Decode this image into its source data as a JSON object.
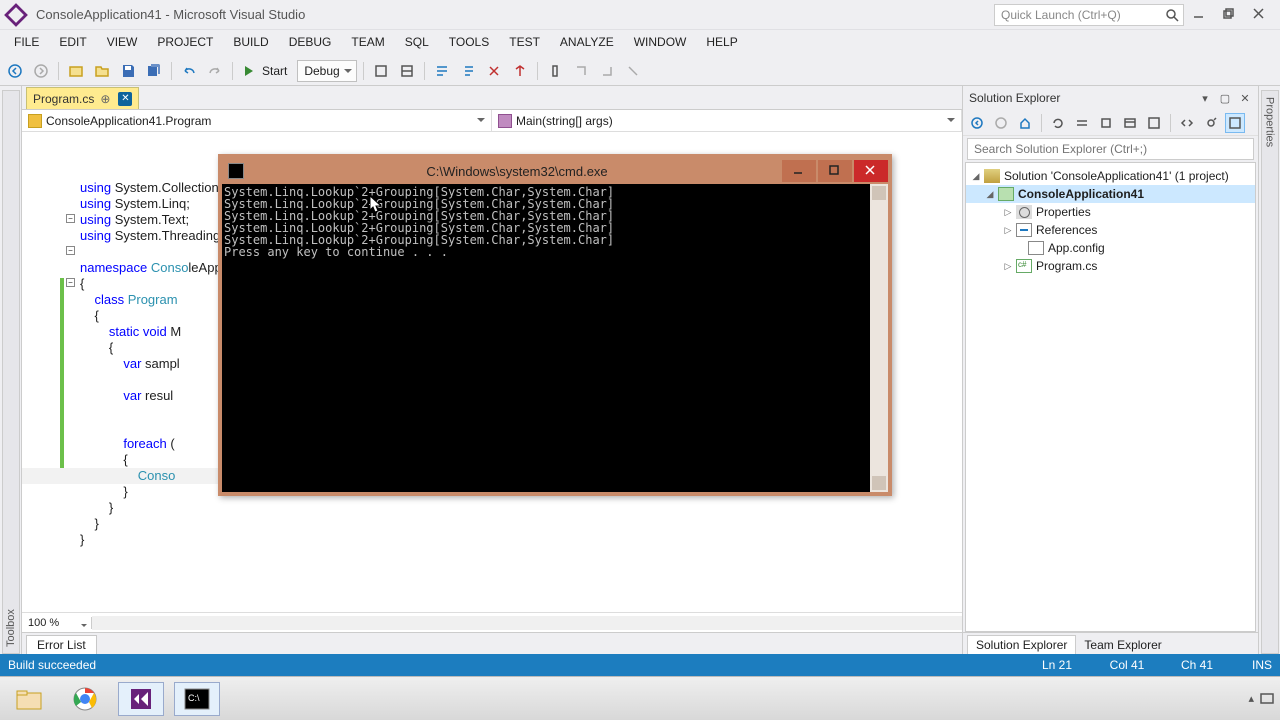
{
  "window": {
    "title": "ConsoleApplication41 - Microsoft Visual Studio",
    "quick_launch_placeholder": "Quick Launch (Ctrl+Q)"
  },
  "menu": [
    "FILE",
    "EDIT",
    "VIEW",
    "PROJECT",
    "BUILD",
    "DEBUG",
    "TEAM",
    "SQL",
    "TOOLS",
    "TEST",
    "ANALYZE",
    "WINDOW",
    "HELP"
  ],
  "toolbar": {
    "start_label": "Start",
    "config": "Debug"
  },
  "tabs": {
    "active": "Program.cs"
  },
  "nav": {
    "left": "ConsoleApplication41.Program",
    "right": "Main(string[] args)"
  },
  "code_lines": [
    "using System.Collections.Generic;",
    "using System.Linq;",
    "using System.Text;",
    "using System.Threading",
    "",
    "namespace ConsoleAppl",
    "{",
    "    class Program",
    "    {",
    "        static void M",
    "        {",
    "            var sampl",
    "",
    "            var resul",
    "",
    "",
    "            foreach (",
    "            {",
    "                Conso",
    "            }",
    "        }",
    "    }",
    "}"
  ],
  "editor": {
    "zoom": "100 %"
  },
  "error_list_label": "Error List",
  "sln": {
    "panel_title": "Solution Explorer",
    "search_placeholder": "Search Solution Explorer (Ctrl+;)",
    "solution": "Solution 'ConsoleApplication41' (1 project)",
    "project": "ConsoleApplication41",
    "nodes": [
      "Properties",
      "References",
      "App.config",
      "Program.cs"
    ],
    "tabs": [
      "Solution Explorer",
      "Team Explorer"
    ]
  },
  "status": {
    "message": "Build succeeded",
    "line": "Ln 21",
    "col": "Col 41",
    "ch": "Ch 41",
    "ins": "INS"
  },
  "cmd": {
    "title": "C:\\Windows\\system32\\cmd.exe",
    "lines": [
      "System.Linq.Lookup`2+Grouping[System.Char,System.Char]",
      "System.Linq.Lookup`2+Grouping[System.Char,System.Char]",
      "System.Linq.Lookup`2+Grouping[System.Char,System.Char]",
      "System.Linq.Lookup`2+Grouping[System.Char,System.Char]",
      "System.Linq.Lookup`2+Grouping[System.Char,System.Char]",
      "Press any key to continue . . ."
    ]
  }
}
